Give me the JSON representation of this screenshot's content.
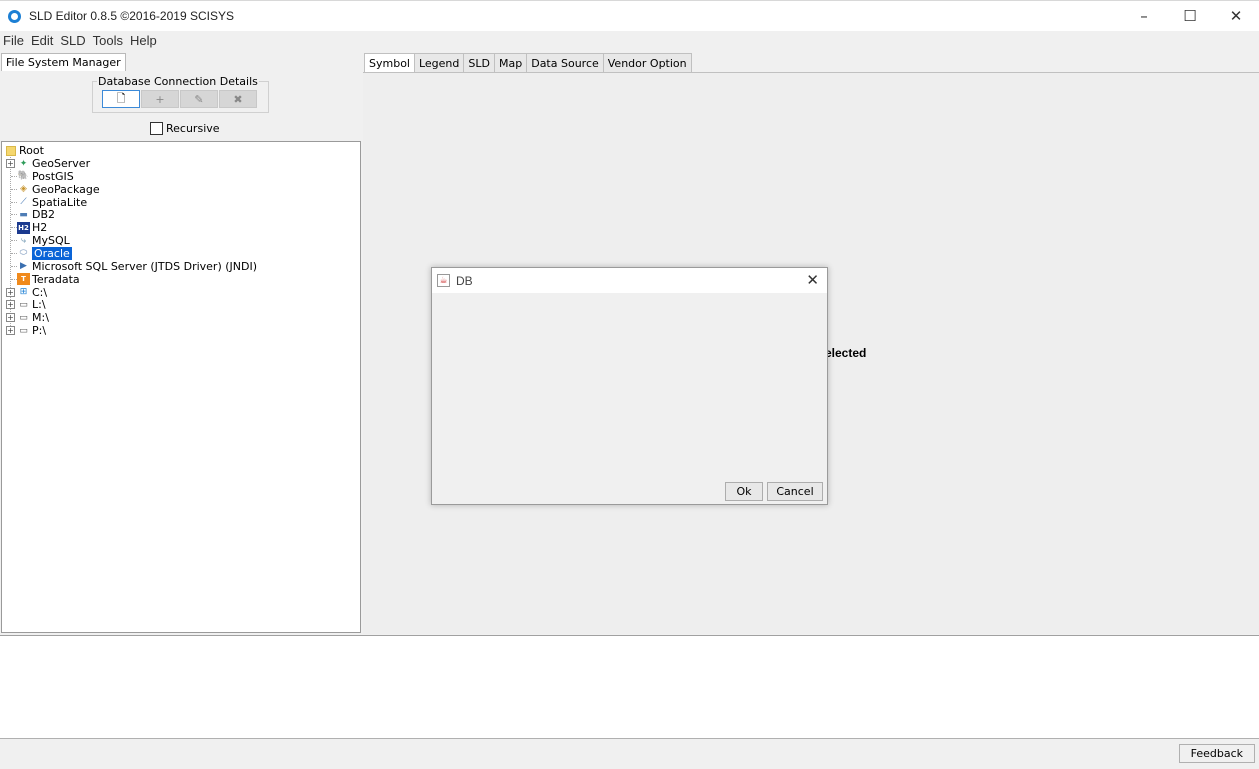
{
  "window": {
    "title": "SLD Editor 0.8.5 ©2016-2019 SCISYS",
    "minimize": "–",
    "maximize": "☐",
    "close": "✕"
  },
  "menu": [
    "File",
    "Edit",
    "SLD",
    "Tools",
    "Help"
  ],
  "left": {
    "tab": "File System Manager",
    "db_group_label": "Database Connection Details",
    "db_buttons": [
      {
        "icon": "new-file-icon",
        "glyph": "🗋"
      },
      {
        "icon": "add-icon",
        "glyph": "+"
      },
      {
        "icon": "edit-icon",
        "glyph": "✎"
      },
      {
        "icon": "delete-icon",
        "glyph": "✖"
      }
    ],
    "recursive_label": "Recursive",
    "recursive_checked": false
  },
  "tree": {
    "root": "Root",
    "nodes": [
      {
        "label": "GeoServer",
        "icon": "geoserver-icon",
        "glyph": "✦",
        "color": "#2e9c5a",
        "expandable": true
      },
      {
        "label": "PostGIS",
        "icon": "postgis-icon",
        "glyph": "🐘",
        "color": "#336791",
        "expandable": false
      },
      {
        "label": "GeoPackage",
        "icon": "geopackage-icon",
        "glyph": "◈",
        "color": "#c8952f",
        "expandable": false
      },
      {
        "label": "SpatiaLite",
        "icon": "spatialite-icon",
        "glyph": "⟋",
        "color": "#3a6fb0",
        "expandable": false
      },
      {
        "label": "DB2",
        "icon": "db2-icon",
        "glyph": "▬",
        "color": "#4f7db5",
        "expandable": false
      },
      {
        "label": "H2",
        "icon": "h2-icon",
        "glyph": "H2",
        "color": "#1b3a8f",
        "expandable": false
      },
      {
        "label": "MySQL",
        "icon": "mysql-icon",
        "glyph": "⤷",
        "color": "#5e8aa8",
        "expandable": false
      },
      {
        "label": "Oracle",
        "icon": "oracle-icon",
        "glyph": "⬭",
        "color": "#6a8bb5",
        "expandable": false,
        "selected": true
      },
      {
        "label": "Microsoft SQL Server (JTDS Driver) (JNDI)",
        "icon": "sqlserver-icon",
        "glyph": "▶",
        "color": "#3a6fb0",
        "expandable": false
      },
      {
        "label": "Teradata",
        "icon": "teradata-icon",
        "glyph": "T",
        "color": "#f08a1c",
        "expandable": false
      },
      {
        "label": "C:\\",
        "icon": "drive-c-icon",
        "glyph": "⊞",
        "color": "#1c7fd4",
        "expandable": true
      },
      {
        "label": "L:\\",
        "icon": "drive-l-icon",
        "glyph": "▭",
        "color": "#555555",
        "expandable": true
      },
      {
        "label": "M:\\",
        "icon": "drive-m-icon",
        "glyph": "▭",
        "color": "#555555",
        "expandable": true
      },
      {
        "label": "P:\\",
        "icon": "drive-p-icon",
        "glyph": "▭",
        "color": "#555555",
        "expandable": true
      }
    ]
  },
  "right": {
    "tabs": [
      "Symbol",
      "Legend",
      "SLD",
      "Map",
      "Data Source",
      "Vendor Option"
    ],
    "active_tab": "Symbol",
    "partial_text": "elected"
  },
  "dialog": {
    "title": "DB",
    "ok": "Ok",
    "cancel": "Cancel"
  },
  "status": {
    "feedback": "Feedback"
  }
}
